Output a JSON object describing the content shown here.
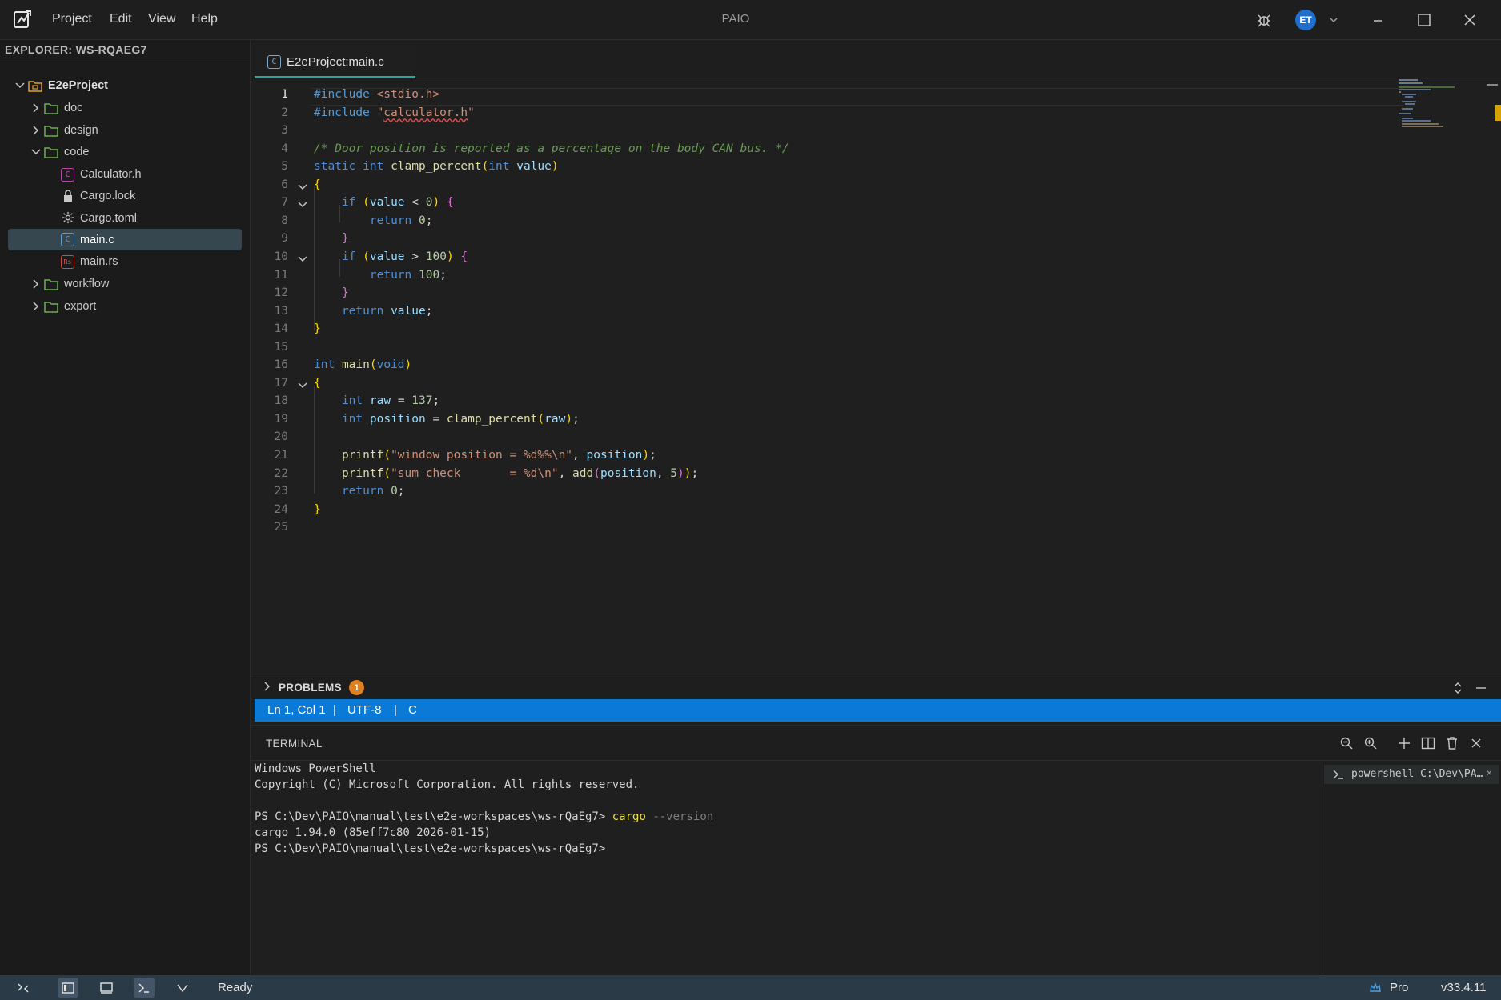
{
  "window": {
    "title": "PAIO",
    "menu": [
      "Project",
      "Edit",
      "View",
      "Help"
    ],
    "user_initials": "ET",
    "icons": [
      "app-logo-icon",
      "debug-icon",
      "chevron-down-icon",
      "minimize-icon",
      "maximize-icon",
      "close-icon"
    ]
  },
  "explorer": {
    "title": "EXPLORER: WS-RQAEG7",
    "tree": [
      {
        "label": "E2eProject",
        "depth": 0,
        "kind": "project",
        "expanded": true
      },
      {
        "label": "doc",
        "depth": 1,
        "kind": "folder",
        "expanded": false
      },
      {
        "label": "design",
        "depth": 1,
        "kind": "folder",
        "expanded": false
      },
      {
        "label": "code",
        "depth": 1,
        "kind": "folder",
        "expanded": true
      },
      {
        "label": "Calculator.h",
        "depth": 2,
        "kind": "c-header"
      },
      {
        "label": "Cargo.lock",
        "depth": 2,
        "kind": "lock"
      },
      {
        "label": "Cargo.toml",
        "depth": 2,
        "kind": "config"
      },
      {
        "label": "main.c",
        "depth": 2,
        "kind": "c-source",
        "selected": true
      },
      {
        "label": "main.rs",
        "depth": 2,
        "kind": "rust"
      },
      {
        "label": "workflow",
        "depth": 1,
        "kind": "folder",
        "expanded": false
      },
      {
        "label": "export",
        "depth": 1,
        "kind": "folder",
        "expanded": false
      }
    ]
  },
  "editor": {
    "tab_label": "E2eProject:main.c",
    "tab_icon": "c-file-icon",
    "active_line": 1,
    "lines": [
      "#include <stdio.h>",
      "#include \"calculator.h\"",
      "",
      "/* Door position is reported as a percentage on the body CAN bus. */",
      "static int clamp_percent(int value)",
      "{",
      "    if (value < 0) {",
      "        return 0;",
      "    }",
      "    if (value > 100) {",
      "        return 100;",
      "    }",
      "    return value;",
      "}",
      "",
      "int main(void)",
      "{",
      "    int raw = 137;",
      "    int position = clamp_percent(raw);",
      "",
      "    printf(\"window position = %d%%\\n\", position);",
      "    printf(\"sum check       = %d\\n\", add(position, 5));",
      "    return 0;",
      "}",
      ""
    ],
    "fold_lines": [
      6,
      7,
      10,
      17
    ],
    "line_numbers": [
      "1",
      "2",
      "3",
      "4",
      "5",
      "6",
      "7",
      "8",
      "9",
      "10",
      "11",
      "12",
      "13",
      "14",
      "15",
      "16",
      "17",
      "18",
      "19",
      "20",
      "21",
      "22",
      "23",
      "24",
      "25"
    ]
  },
  "problems": {
    "title": "PROBLEMS",
    "count": "1",
    "count_color": "#e0801f"
  },
  "cursor_info": {
    "position": "Ln 1, Col 1",
    "sep1": "|",
    "encoding": "UTF-8",
    "sep2": "|",
    "language": "C"
  },
  "terminal": {
    "title": "TERMINAL",
    "lines": [
      {
        "text": "Windows PowerShell"
      },
      {
        "text": "Copyright (C) Microsoft Corporation. All rights reserved."
      },
      {
        "text": ""
      },
      {
        "prompt": "PS C:\\Dev\\PAIO\\manual\\test\\e2e-workspaces\\ws-rQaEg7> ",
        "cmd": "cargo",
        "args": " --version"
      },
      {
        "text": "cargo 1.94.0 (85eff7c80 2026-01-15)"
      },
      {
        "text": "PS C:\\Dev\\PAIO\\manual\\test\\e2e-workspaces\\ws-rQaEg7>"
      }
    ],
    "session_label": "powershell C:\\Dev\\PA…",
    "session_close": "×",
    "header_icons": [
      "zoom-out-icon",
      "zoom-in-icon",
      "plus-icon",
      "split-icon",
      "trash-icon",
      "close-icon"
    ]
  },
  "statusbar": {
    "status": "Ready",
    "plan": "Pro",
    "version": "v33.4.11",
    "accent": "#0a7ad6"
  }
}
